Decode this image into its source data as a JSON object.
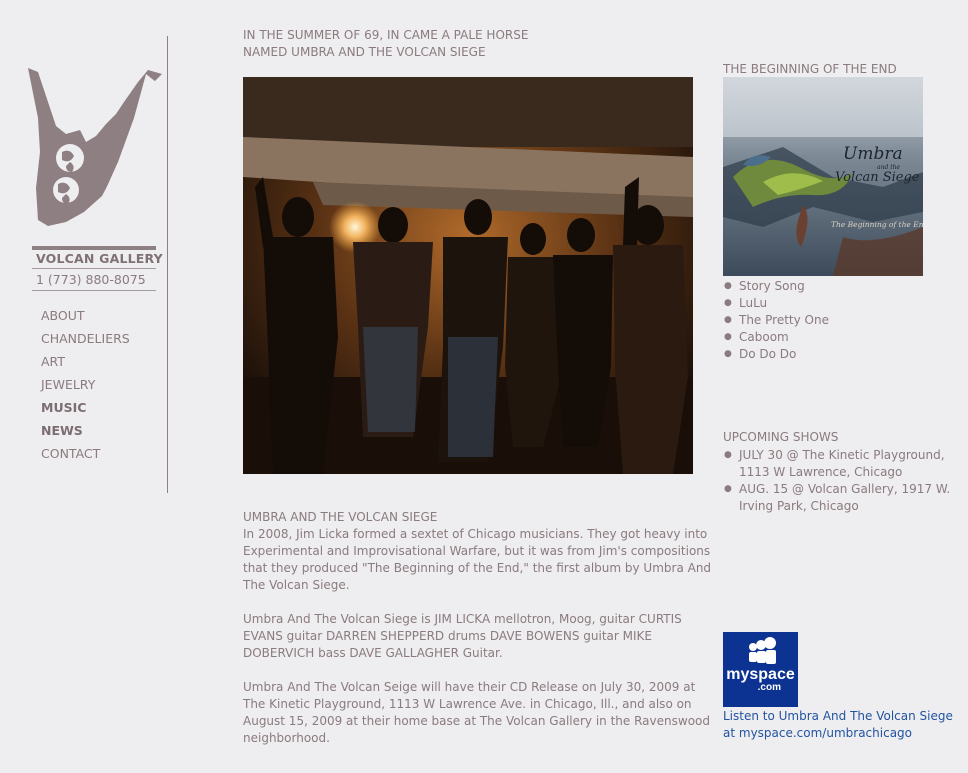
{
  "sidebar": {
    "brand": "VOLCAN GALLERY",
    "phone": "1 (773) 880-8075",
    "nav": [
      {
        "label": "ABOUT",
        "bold": false
      },
      {
        "label": "CHANDELIERS",
        "bold": false
      },
      {
        "label": "ART",
        "bold": false
      },
      {
        "label": "JEWELRY",
        "bold": false
      },
      {
        "label": "MUSIC",
        "bold": true
      },
      {
        "label": "NEWS",
        "bold": true
      },
      {
        "label": "CONTACT",
        "bold": false
      }
    ]
  },
  "main": {
    "headline_line1": "IN THE SUMMER OF 69, IN CAME A PALE HORSE",
    "headline_line2": "NAMED UMBRA AND THE VOLCAN SIEGE",
    "article": {
      "title": "UMBRA AND THE VOLCAN SIEGE",
      "paragraph1": "In 2008, Jim Licka formed a sextet of Chicago musicians. They got heavy into Experimental and Improvisational Warfare, but it was from Jim's compositions that they produced \"The Beginning of the End,\" the first album by Umbra And The Volcan Siege.",
      "paragraph2": "Umbra And The Volcan Siege is JIM LICKA mellotron, Moog, guitar CURTIS EVANS guitar DARREN SHEPPERD drums DAVE BOWENS guitar MIKE DOBERVICH bass DAVE GALLAGHER Guitar.",
      "paragraph3": "Umbra And The Volcan Seige will have their CD Release on July 30, 2009 at The Kinetic Playground, 1113 W Lawrence Ave. in Chicago, Ill., and also on August 15, 2009 at their home base at The Volcan Gallery in the Ravenswood neighborhood."
    }
  },
  "right": {
    "album_title": "THE BEGINNING OF THE END",
    "cover_text": {
      "line1": "Umbra",
      "line2": "and the",
      "line3": "Volcan Siege",
      "subtitle": "The Beginning of the End"
    },
    "tracks": [
      "Story Song",
      "LuLu",
      "The Pretty One",
      "Caboom",
      "Do Do Do"
    ],
    "shows_title": "UPCOMING SHOWS",
    "shows": [
      "JULY 30 @ The Kinetic Playground, 1113 W Lawrence, Chicago",
      "AUG. 15 @ Volcan Gallery, 1917 W. Irving Park, Chicago"
    ],
    "myspace_logo": "myspace",
    "myspace_logo_suffix": ".com",
    "myspace_link_line1": "Listen to Umbra And The Volcan Siege",
    "myspace_link_line2": "at myspace.com/umbrachicago"
  },
  "bullet": "●",
  "colors": {
    "background": "#eeedef",
    "text": "#8a7b7e",
    "logo": "#8d7f82",
    "link": "#2254a3",
    "myspace_blue": "#0c3391"
  }
}
